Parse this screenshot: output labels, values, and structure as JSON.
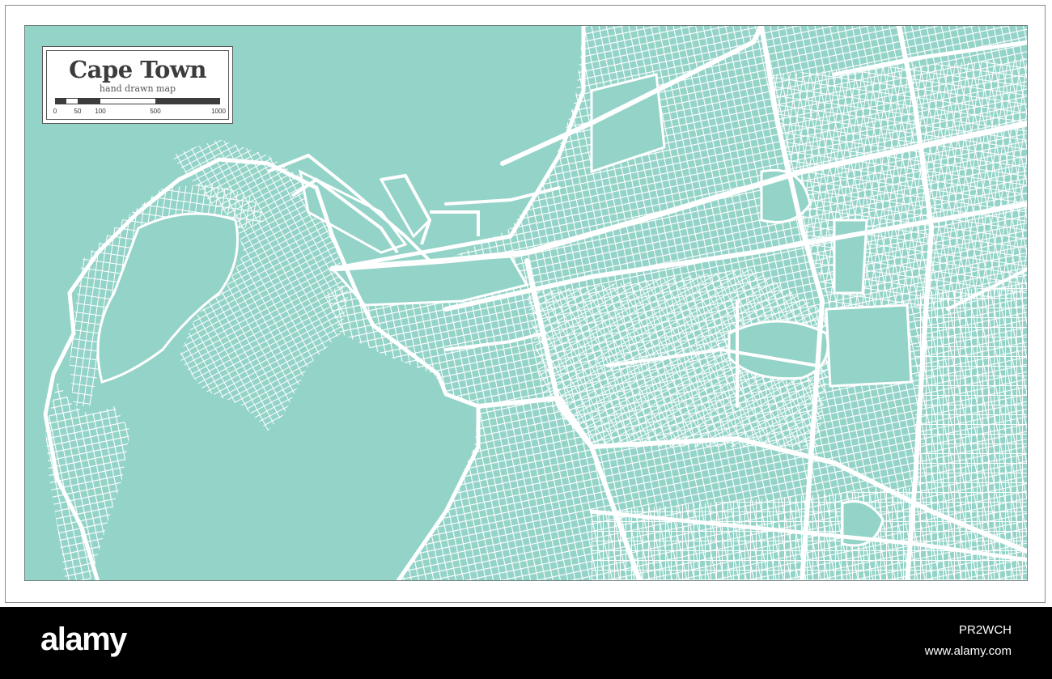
{
  "map": {
    "title": "Cape Town",
    "subtitle": "hand drawn map",
    "scale_labels": [
      "0",
      "50",
      "100",
      "500",
      "1000"
    ],
    "water_color": "#93d3c8",
    "road_color": "#ffffff"
  },
  "footer": {
    "brand": "alamy",
    "image_id": "PR2WCH",
    "url": "www.alamy.com"
  }
}
